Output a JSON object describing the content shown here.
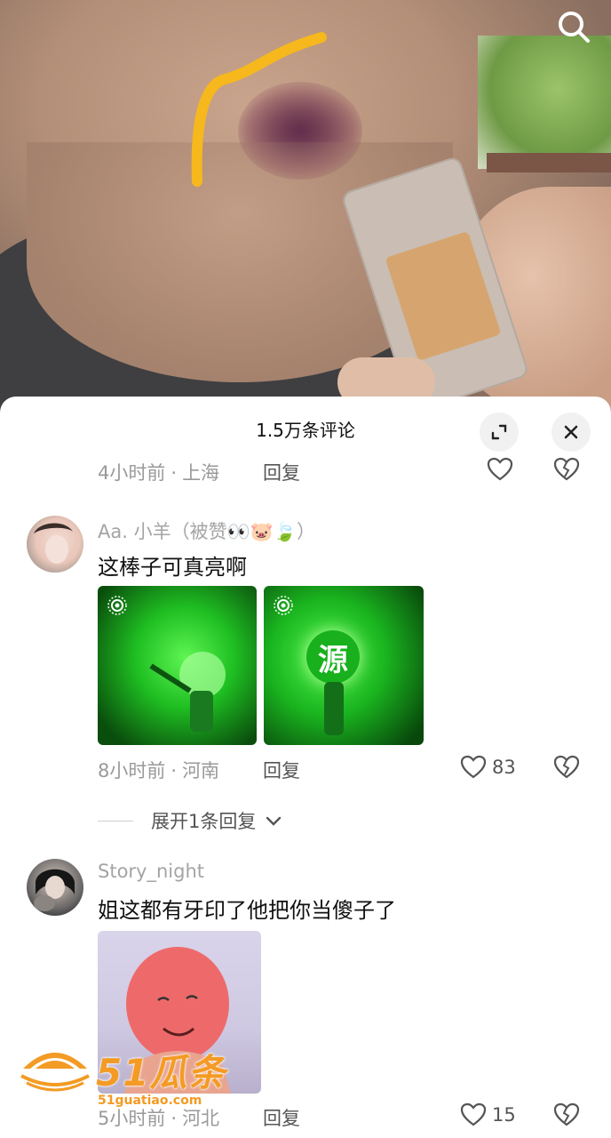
{
  "sheet": {
    "title": "1.5万条评论"
  },
  "icons": {
    "search": "search-icon",
    "expand": "expand-icon",
    "close": "close-icon",
    "like": "heart-icon",
    "dislike": "broken-heart-icon",
    "chevron": "chevron-down-icon",
    "live_badge": "live-badge-icon"
  },
  "comments": [
    {
      "time": "4小时前",
      "location": "上海",
      "reply_label": "回复"
    },
    {
      "username": "Aa. 小羊（被赞👀🐷🍃）",
      "text": "这棒子可真亮啊",
      "image2_char": "源",
      "time": "8小时前",
      "location": "河南",
      "reply_label": "回复",
      "likes": "83",
      "expand_label": "展开1条回复"
    },
    {
      "username": "Story_night",
      "text": "姐这都有牙印了他把你当傻子了",
      "time": "5小时前",
      "location": "河北",
      "reply_label": "回复",
      "likes": "15"
    }
  ],
  "watermark": {
    "brand": "51瓜条",
    "url": "51guatiao.com"
  },
  "colors": {
    "accent_orange": "#f39b24",
    "highlighter_yellow": "#f6b81c",
    "glow_green": "#1fd12a"
  }
}
